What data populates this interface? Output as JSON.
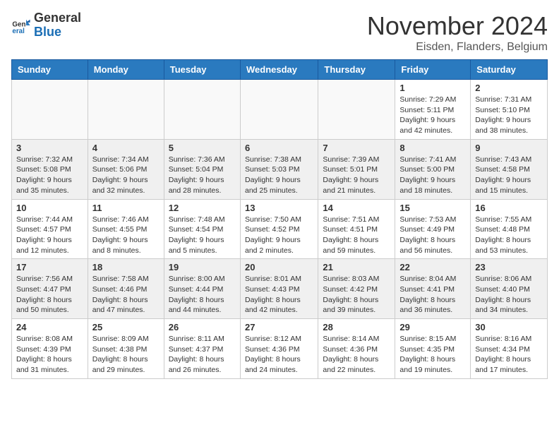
{
  "header": {
    "logo_general": "General",
    "logo_blue": "Blue",
    "title": "November 2024",
    "subtitle": "Eisden, Flanders, Belgium"
  },
  "days_of_week": [
    "Sunday",
    "Monday",
    "Tuesday",
    "Wednesday",
    "Thursday",
    "Friday",
    "Saturday"
  ],
  "weeks": [
    [
      {
        "day": "",
        "info": ""
      },
      {
        "day": "",
        "info": ""
      },
      {
        "day": "",
        "info": ""
      },
      {
        "day": "",
        "info": ""
      },
      {
        "day": "",
        "info": ""
      },
      {
        "day": "1",
        "info": "Sunrise: 7:29 AM\nSunset: 5:11 PM\nDaylight: 9 hours and 42 minutes."
      },
      {
        "day": "2",
        "info": "Sunrise: 7:31 AM\nSunset: 5:10 PM\nDaylight: 9 hours and 38 minutes."
      }
    ],
    [
      {
        "day": "3",
        "info": "Sunrise: 7:32 AM\nSunset: 5:08 PM\nDaylight: 9 hours and 35 minutes."
      },
      {
        "day": "4",
        "info": "Sunrise: 7:34 AM\nSunset: 5:06 PM\nDaylight: 9 hours and 32 minutes."
      },
      {
        "day": "5",
        "info": "Sunrise: 7:36 AM\nSunset: 5:04 PM\nDaylight: 9 hours and 28 minutes."
      },
      {
        "day": "6",
        "info": "Sunrise: 7:38 AM\nSunset: 5:03 PM\nDaylight: 9 hours and 25 minutes."
      },
      {
        "day": "7",
        "info": "Sunrise: 7:39 AM\nSunset: 5:01 PM\nDaylight: 9 hours and 21 minutes."
      },
      {
        "day": "8",
        "info": "Sunrise: 7:41 AM\nSunset: 5:00 PM\nDaylight: 9 hours and 18 minutes."
      },
      {
        "day": "9",
        "info": "Sunrise: 7:43 AM\nSunset: 4:58 PM\nDaylight: 9 hours and 15 minutes."
      }
    ],
    [
      {
        "day": "10",
        "info": "Sunrise: 7:44 AM\nSunset: 4:57 PM\nDaylight: 9 hours and 12 minutes."
      },
      {
        "day": "11",
        "info": "Sunrise: 7:46 AM\nSunset: 4:55 PM\nDaylight: 9 hours and 8 minutes."
      },
      {
        "day": "12",
        "info": "Sunrise: 7:48 AM\nSunset: 4:54 PM\nDaylight: 9 hours and 5 minutes."
      },
      {
        "day": "13",
        "info": "Sunrise: 7:50 AM\nSunset: 4:52 PM\nDaylight: 9 hours and 2 minutes."
      },
      {
        "day": "14",
        "info": "Sunrise: 7:51 AM\nSunset: 4:51 PM\nDaylight: 8 hours and 59 minutes."
      },
      {
        "day": "15",
        "info": "Sunrise: 7:53 AM\nSunset: 4:49 PM\nDaylight: 8 hours and 56 minutes."
      },
      {
        "day": "16",
        "info": "Sunrise: 7:55 AM\nSunset: 4:48 PM\nDaylight: 8 hours and 53 minutes."
      }
    ],
    [
      {
        "day": "17",
        "info": "Sunrise: 7:56 AM\nSunset: 4:47 PM\nDaylight: 8 hours and 50 minutes."
      },
      {
        "day": "18",
        "info": "Sunrise: 7:58 AM\nSunset: 4:46 PM\nDaylight: 8 hours and 47 minutes."
      },
      {
        "day": "19",
        "info": "Sunrise: 8:00 AM\nSunset: 4:44 PM\nDaylight: 8 hours and 44 minutes."
      },
      {
        "day": "20",
        "info": "Sunrise: 8:01 AM\nSunset: 4:43 PM\nDaylight: 8 hours and 42 minutes."
      },
      {
        "day": "21",
        "info": "Sunrise: 8:03 AM\nSunset: 4:42 PM\nDaylight: 8 hours and 39 minutes."
      },
      {
        "day": "22",
        "info": "Sunrise: 8:04 AM\nSunset: 4:41 PM\nDaylight: 8 hours and 36 minutes."
      },
      {
        "day": "23",
        "info": "Sunrise: 8:06 AM\nSunset: 4:40 PM\nDaylight: 8 hours and 34 minutes."
      }
    ],
    [
      {
        "day": "24",
        "info": "Sunrise: 8:08 AM\nSunset: 4:39 PM\nDaylight: 8 hours and 31 minutes."
      },
      {
        "day": "25",
        "info": "Sunrise: 8:09 AM\nSunset: 4:38 PM\nDaylight: 8 hours and 29 minutes."
      },
      {
        "day": "26",
        "info": "Sunrise: 8:11 AM\nSunset: 4:37 PM\nDaylight: 8 hours and 26 minutes."
      },
      {
        "day": "27",
        "info": "Sunrise: 8:12 AM\nSunset: 4:36 PM\nDaylight: 8 hours and 24 minutes."
      },
      {
        "day": "28",
        "info": "Sunrise: 8:14 AM\nSunset: 4:36 PM\nDaylight: 8 hours and 22 minutes."
      },
      {
        "day": "29",
        "info": "Sunrise: 8:15 AM\nSunset: 4:35 PM\nDaylight: 8 hours and 19 minutes."
      },
      {
        "day": "30",
        "info": "Sunrise: 8:16 AM\nSunset: 4:34 PM\nDaylight: 8 hours and 17 minutes."
      }
    ]
  ]
}
